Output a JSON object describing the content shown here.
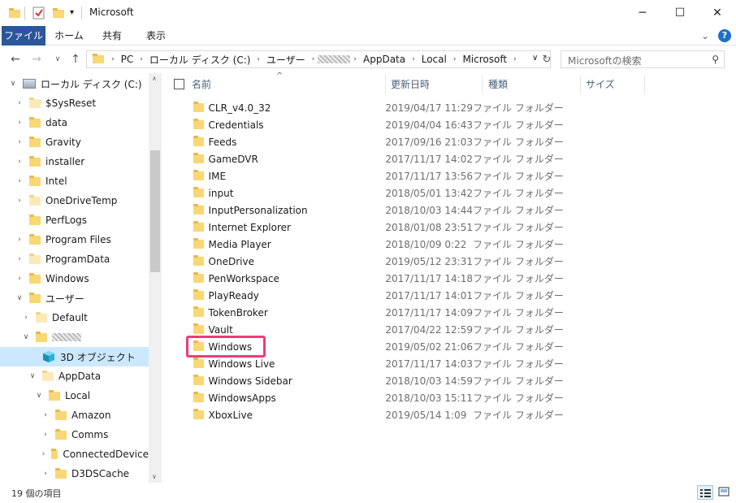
{
  "window": {
    "title": "Microsoft",
    "minimize": "─",
    "maximize": "☐",
    "close": "✕"
  },
  "ribbon": {
    "tabs": [
      "ファイル",
      "ホーム",
      "共有",
      "表示"
    ],
    "collapse": "⌄",
    "help": "?"
  },
  "address": {
    "crumbs": [
      "PC",
      "ローカル ディスク (C:)",
      "ユーザー",
      "",
      "AppData",
      "Local",
      "Microsoft"
    ],
    "search_placeholder": "Microsoftの検索"
  },
  "nav": {
    "items": [
      {
        "label": "ローカル ディスク (C:)",
        "depth": 0,
        "chev": "∨",
        "icon": "drive-icon"
      },
      {
        "label": "$SysReset",
        "depth": 1,
        "chev": "›",
        "icon": "pale"
      },
      {
        "label": "data",
        "depth": 1,
        "chev": "›",
        "icon": "folder"
      },
      {
        "label": "Gravity",
        "depth": 1,
        "chev": "›",
        "icon": "folder"
      },
      {
        "label": "installer",
        "depth": 1,
        "chev": "›",
        "icon": "folder"
      },
      {
        "label": "Intel",
        "depth": 1,
        "chev": "›",
        "icon": "folder"
      },
      {
        "label": "OneDriveTemp",
        "depth": 1,
        "chev": "›",
        "icon": "pale"
      },
      {
        "label": "PerfLogs",
        "depth": 1,
        "chev": "",
        "icon": "folder"
      },
      {
        "label": "Program Files",
        "depth": 1,
        "chev": "›",
        "icon": "folder"
      },
      {
        "label": "ProgramData",
        "depth": 1,
        "chev": "›",
        "icon": "pale"
      },
      {
        "label": "Windows",
        "depth": 1,
        "chev": "›",
        "icon": "folder"
      },
      {
        "label": "ユーザー",
        "depth": 1,
        "chev": "∨",
        "icon": "folder"
      },
      {
        "label": "Default",
        "depth": 2,
        "chev": "›",
        "icon": "pale"
      },
      {
        "label": "",
        "depth": 2,
        "chev": "∨",
        "icon": "folder"
      },
      {
        "label": "3D オブジェクト",
        "depth": 3,
        "chev": "",
        "icon": "cube-icon",
        "selected": true
      },
      {
        "label": "AppData",
        "depth": 3,
        "chev": "∨",
        "icon": "pale"
      },
      {
        "label": "Local",
        "depth": 4,
        "chev": "∨",
        "icon": "folder"
      },
      {
        "label": "Amazon",
        "depth": 5,
        "chev": "›",
        "icon": "folder"
      },
      {
        "label": "Comms",
        "depth": 5,
        "chev": "›",
        "icon": "folder"
      },
      {
        "label": "ConnectedDevice",
        "depth": 5,
        "chev": "›",
        "icon": "folder"
      },
      {
        "label": "D3DSCache",
        "depth": 5,
        "chev": "›",
        "icon": "folder"
      }
    ]
  },
  "columns": {
    "name": "名前",
    "date": "更新日時",
    "type": "種類",
    "size": "サイズ",
    "sort_indicator": "^"
  },
  "files": [
    {
      "name": "CLR_v4.0_32",
      "date": "2019/04/17 11:29",
      "type": "ファイル フォルダー"
    },
    {
      "name": "Credentials",
      "date": "2019/04/04 16:43",
      "type": "ファイル フォルダー"
    },
    {
      "name": "Feeds",
      "date": "2017/09/16 21:03",
      "type": "ファイル フォルダー"
    },
    {
      "name": "GameDVR",
      "date": "2017/11/17 14:02",
      "type": "ファイル フォルダー"
    },
    {
      "name": "IME",
      "date": "2017/11/17 13:56",
      "type": "ファイル フォルダー"
    },
    {
      "name": "input",
      "date": "2018/05/01 13:42",
      "type": "ファイル フォルダー"
    },
    {
      "name": "InputPersonalization",
      "date": "2018/10/03 14:44",
      "type": "ファイル フォルダー"
    },
    {
      "name": "Internet Explorer",
      "date": "2018/01/08 23:51",
      "type": "ファイル フォルダー"
    },
    {
      "name": "Media Player",
      "date": "2018/10/09 0:22",
      "type": "ファイル フォルダー"
    },
    {
      "name": "OneDrive",
      "date": "2019/05/12 23:31",
      "type": "ファイル フォルダー"
    },
    {
      "name": "PenWorkspace",
      "date": "2017/11/17 14:18",
      "type": "ファイル フォルダー"
    },
    {
      "name": "PlayReady",
      "date": "2017/11/17 14:01",
      "type": "ファイル フォルダー"
    },
    {
      "name": "TokenBroker",
      "date": "2017/11/17 14:09",
      "type": "ファイル フォルダー"
    },
    {
      "name": "Vault",
      "date": "2017/04/22 12:59",
      "type": "ファイル フォルダー"
    },
    {
      "name": "Windows",
      "date": "2019/05/02 21:06",
      "type": "ファイル フォルダー"
    },
    {
      "name": "Windows Live",
      "date": "2017/11/17 14:03",
      "type": "ファイル フォルダー"
    },
    {
      "name": "Windows Sidebar",
      "date": "2018/10/03 14:59",
      "type": "ファイル フォルダー"
    },
    {
      "name": "WindowsApps",
      "date": "2018/10/03 15:11",
      "type": "ファイル フォルダー"
    },
    {
      "name": "XboxLive",
      "date": "2019/05/14 1:09",
      "type": "ファイル フォルダー"
    }
  ],
  "status": {
    "count": "19 個の項目"
  },
  "colors": {
    "accent": "#2b579a",
    "selection": "#cce8ff",
    "highlight": "#ee3b7a"
  }
}
